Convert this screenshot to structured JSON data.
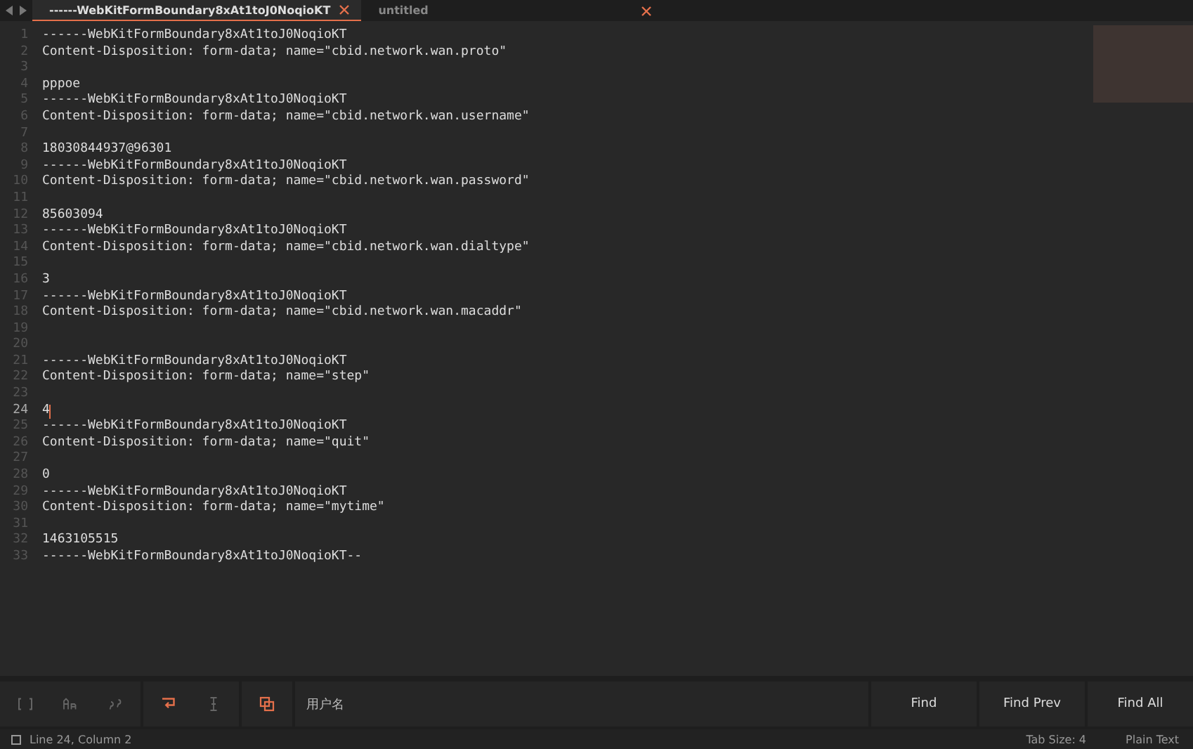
{
  "tabs": [
    {
      "label": "------WebKitFormBoundary8xAt1toJ0NoqioKT",
      "selected": true
    },
    {
      "label": "untitled",
      "selected": false
    }
  ],
  "editor": {
    "lines": [
      {
        "number": "1",
        "text": "------WebKitFormBoundary8xAt1toJ0NoqioKT",
        "current": false
      },
      {
        "number": "2",
        "text": "Content-Disposition: form-data; name=\"cbid.network.wan.proto\"",
        "current": false
      },
      {
        "number": "3",
        "current": false
      },
      {
        "number": "4",
        "text": "pppoe",
        "current": false
      },
      {
        "number": "5",
        "text": "------WebKitFormBoundary8xAt1toJ0NoqioKT",
        "current": false
      },
      {
        "number": "6",
        "text": "Content-Disposition: form-data; name=\"cbid.network.wan.username\"",
        "current": false
      },
      {
        "number": "7",
        "current": false
      },
      {
        "number": "8",
        "text": "18030844937@96301",
        "current": false
      },
      {
        "number": "9",
        "text": "------WebKitFormBoundary8xAt1toJ0NoqioKT",
        "current": false
      },
      {
        "number": "10",
        "text": "Content-Disposition: form-data; name=\"cbid.network.wan.password\"",
        "current": false
      },
      {
        "number": "11",
        "current": false
      },
      {
        "number": "12",
        "text": "85603094",
        "current": false
      },
      {
        "number": "13",
        "text": "------WebKitFormBoundary8xAt1toJ0NoqioKT",
        "current": false
      },
      {
        "number": "14",
        "text": "Content-Disposition: form-data; name=\"cbid.network.wan.dialtype\"",
        "current": false
      },
      {
        "number": "15",
        "current": false
      },
      {
        "number": "16",
        "text": "3",
        "current": false
      },
      {
        "number": "17",
        "text": "------WebKitFormBoundary8xAt1toJ0NoqioKT",
        "current": false
      },
      {
        "number": "18",
        "text": "Content-Disposition: form-data; name=\"cbid.network.wan.macaddr\"",
        "current": false
      },
      {
        "number": "19",
        "current": false
      },
      {
        "number": "20",
        "current": false
      },
      {
        "number": "21",
        "text": "------WebKitFormBoundary8xAt1toJ0NoqioKT",
        "current": false
      },
      {
        "number": "22",
        "text": "Content-Disposition: form-data; name=\"step\"",
        "current": false
      },
      {
        "number": "23",
        "current": false
      },
      {
        "number": "24",
        "text": "4",
        "current": true
      },
      {
        "number": "25",
        "text": "------WebKitFormBoundary8xAt1toJ0NoqioKT",
        "current": false
      },
      {
        "number": "26",
        "text": "Content-Disposition: form-data; name=\"quit\"",
        "current": false
      },
      {
        "number": "27",
        "current": false
      },
      {
        "number": "28",
        "text": "0",
        "current": false
      },
      {
        "number": "29",
        "text": "------WebKitFormBoundary8xAt1toJ0NoqioKT",
        "current": false
      },
      {
        "number": "30",
        "text": "Content-Disposition: form-data; name=\"mytime\"",
        "current": false
      },
      {
        "number": "31",
        "current": false
      },
      {
        "number": "32",
        "text": "1463105515",
        "current": false
      },
      {
        "number": "33",
        "text": "------WebKitFormBoundary8xAt1toJ0NoqioKT--",
        "current": false
      }
    ]
  },
  "find_panel": {
    "toggles": [
      {
        "kind": "regex",
        "on": false
      },
      {
        "kind": "case",
        "on": false
      },
      {
        "kind": "word",
        "on": false
      },
      {
        "kind": "wrap",
        "on": true
      },
      {
        "kind": "selection",
        "on": false
      },
      {
        "kind": "highlight",
        "on": true
      }
    ],
    "search_value": "用户名",
    "buttons": [
      "Find",
      "Find Prev",
      "Find All"
    ]
  },
  "status_bar": {
    "position": "Line 24, Column 2",
    "tab_size": "Tab Size: 4",
    "syntax": "Plain Text"
  }
}
